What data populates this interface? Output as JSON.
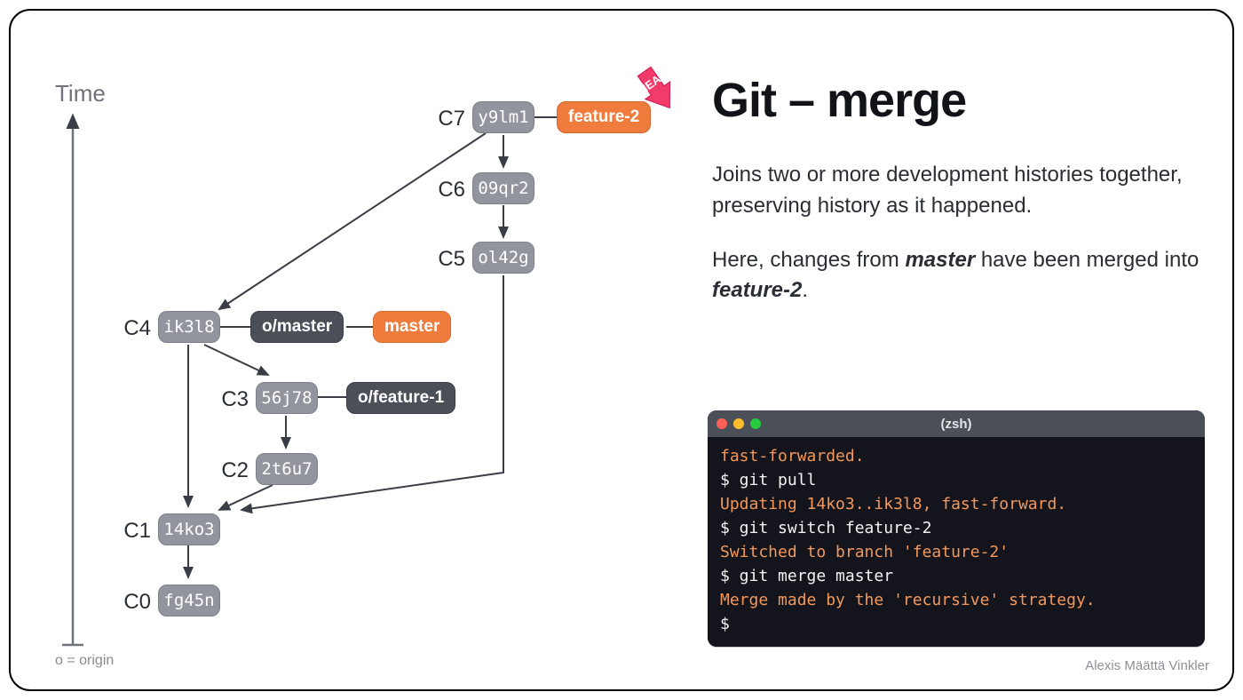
{
  "title": "Git – merge",
  "description_p1": "Joins two or more development histories together, preserving history as it happened.",
  "description_p2_pre": "Here, changes from ",
  "description_p2_b1": "master",
  "description_p2_mid": " have been merged into ",
  "description_p2_b2": "feature-2",
  "description_p2_post": ".",
  "time_label": "Time",
  "origin_label": "o = origin",
  "head_label": "HEAD",
  "author": "Alexis Määttä Vinkler",
  "commits": {
    "c7": {
      "label": "C7",
      "hash": "y9lm1"
    },
    "c6": {
      "label": "C6",
      "hash": "09qr2"
    },
    "c5": {
      "label": "C5",
      "hash": "ol42g"
    },
    "c4": {
      "label": "C4",
      "hash": "ik3l8"
    },
    "c3": {
      "label": "C3",
      "hash": "56j78"
    },
    "c2": {
      "label": "C2",
      "hash": "2t6u7"
    },
    "c1": {
      "label": "C1",
      "hash": "14ko3"
    },
    "c0": {
      "label": "C0",
      "hash": "fg45n"
    }
  },
  "branches": {
    "feature2": "feature-2",
    "master": "master",
    "o_master": "o/master",
    "o_feature1": "o/feature-1"
  },
  "terminal": {
    "title": "(zsh)",
    "lines": [
      {
        "type": "out",
        "text": "fast-forwarded."
      },
      {
        "type": "cmd",
        "text": "$ git pull"
      },
      {
        "type": "out",
        "text": "Updating 14ko3..ik3l8, fast-forward."
      },
      {
        "type": "cmd",
        "text": "$ git switch feature-2"
      },
      {
        "type": "out",
        "text": "Switched to branch 'feature-2'"
      },
      {
        "type": "cmd",
        "text": "$ git merge master"
      },
      {
        "type": "out",
        "text": "Merge made by the 'recursive' strategy."
      },
      {
        "type": "cmd",
        "text": "$"
      }
    ]
  }
}
